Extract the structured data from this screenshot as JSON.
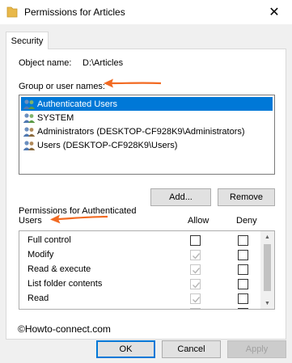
{
  "window": {
    "title": "Permissions for Articles",
    "close_glyph": "✕"
  },
  "tabs": [
    {
      "label": "Security",
      "active": true
    }
  ],
  "object": {
    "label": "Object name:",
    "value": "D:\\Articles"
  },
  "groups": {
    "label": "Group or user names:",
    "items": [
      {
        "label": "Authenticated Users",
        "icon": "users-group-icon",
        "selected": true
      },
      {
        "label": "SYSTEM",
        "icon": "users-group-icon",
        "selected": false
      },
      {
        "label": "Administrators (DESKTOP-CF928K9\\Administrators)",
        "icon": "users-group-icon",
        "selected": false
      },
      {
        "label": "Users (DESKTOP-CF928K9\\Users)",
        "icon": "users-group-icon",
        "selected": false
      }
    ]
  },
  "buttons": {
    "add": "Add...",
    "remove": "Remove",
    "ok": "OK",
    "cancel": "Cancel",
    "apply": "Apply"
  },
  "permissions": {
    "label_line1": "Permissions for Authenticated",
    "label_line2": "Users",
    "allow_header": "Allow",
    "deny_header": "Deny",
    "rows": [
      {
        "name": "Full control",
        "allow": false,
        "allow_disabled": false,
        "deny": false
      },
      {
        "name": "Modify",
        "allow": true,
        "allow_disabled": true,
        "deny": false
      },
      {
        "name": "Read & execute",
        "allow": true,
        "allow_disabled": true,
        "deny": false
      },
      {
        "name": "List folder contents",
        "allow": true,
        "allow_disabled": true,
        "deny": false
      },
      {
        "name": "Read",
        "allow": true,
        "allow_disabled": true,
        "deny": false
      },
      {
        "name": "",
        "allow": true,
        "allow_disabled": true,
        "deny": false
      }
    ]
  },
  "watermark": "©Howto-connect.com",
  "colors": {
    "accent": "#0078d7",
    "arrow": "#f26a22",
    "folder": "#e8b84a"
  }
}
